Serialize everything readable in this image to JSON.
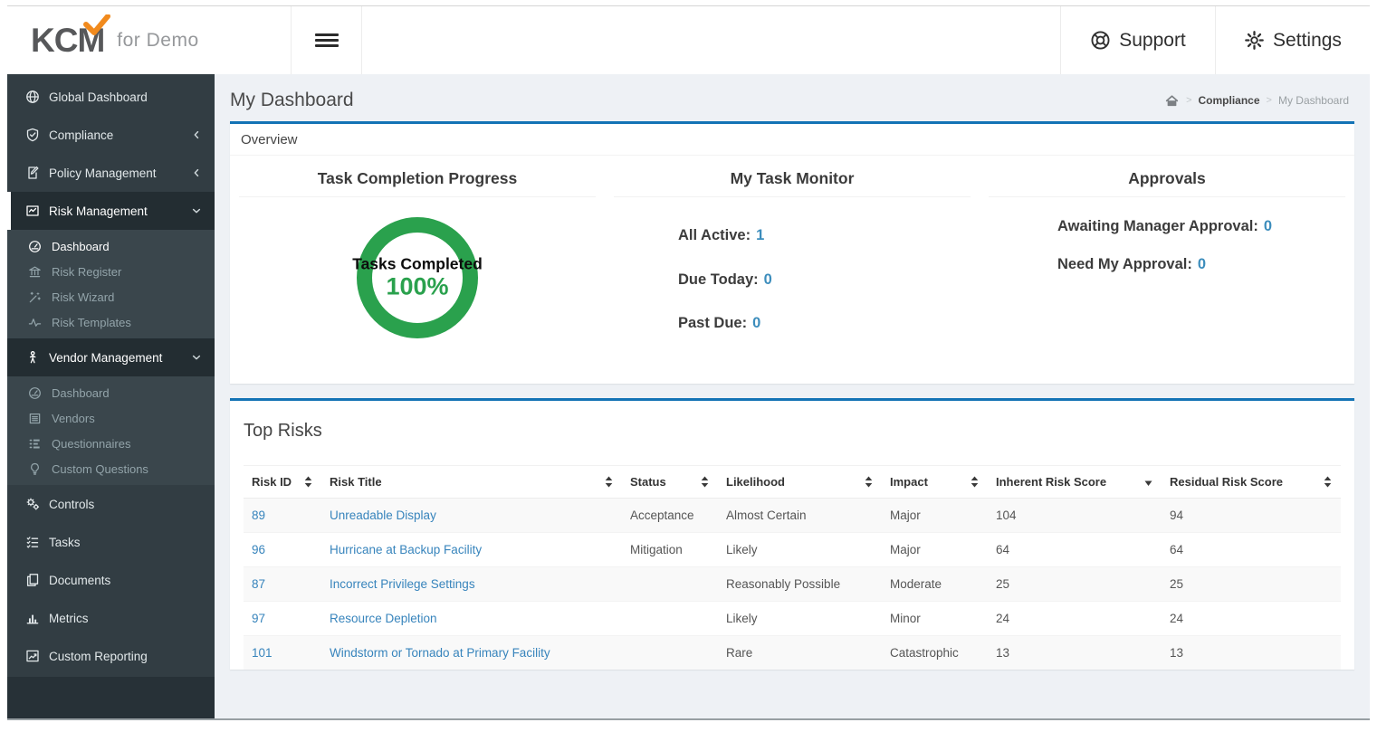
{
  "header": {
    "logo": {
      "brand": "KCM",
      "suffix": "for Demo"
    },
    "nav": [
      {
        "label": "Support",
        "icon": "life-ring"
      },
      {
        "label": "Settings",
        "icon": "gear"
      }
    ]
  },
  "page": {
    "title": "My Dashboard",
    "breadcrumb": {
      "parent": "Compliance",
      "current": "My Dashboard"
    }
  },
  "sidebar": {
    "items": [
      {
        "label": "Global Dashboard",
        "icon": "globe",
        "type": "top"
      },
      {
        "label": "Compliance",
        "icon": "shield-check",
        "type": "top",
        "chevron": "left"
      },
      {
        "label": "Policy Management",
        "icon": "policy-doc",
        "type": "top",
        "chevron": "left"
      },
      {
        "label": "Risk Management",
        "icon": "risk-chart",
        "type": "top",
        "chevron": "down",
        "expanded": true,
        "active": true
      },
      {
        "label": "Dashboard",
        "icon": "gauge",
        "type": "sub",
        "group": "risk",
        "active": true
      },
      {
        "label": "Risk Register",
        "icon": "bank",
        "type": "sub",
        "group": "risk"
      },
      {
        "label": "Risk Wizard",
        "icon": "wand",
        "type": "sub",
        "group": "risk"
      },
      {
        "label": "Risk Templates",
        "icon": "pulse",
        "type": "sub",
        "group": "risk"
      },
      {
        "label": "Vendor Management",
        "icon": "person",
        "type": "top",
        "chevron": "down",
        "expanded": true
      },
      {
        "label": "Dashboard",
        "icon": "gauge",
        "type": "sub",
        "group": "vendor"
      },
      {
        "label": "Vendors",
        "icon": "list-box",
        "type": "sub",
        "group": "vendor"
      },
      {
        "label": "Questionnaires",
        "icon": "list-items",
        "type": "sub",
        "group": "vendor"
      },
      {
        "label": "Custom Questions",
        "icon": "lightbulb",
        "type": "sub",
        "group": "vendor"
      },
      {
        "label": "Controls",
        "icon": "gears",
        "type": "top"
      },
      {
        "label": "Tasks",
        "icon": "task-list",
        "type": "top"
      },
      {
        "label": "Documents",
        "icon": "documents",
        "type": "top"
      },
      {
        "label": "Metrics",
        "icon": "bar-chart",
        "type": "top"
      },
      {
        "label": "Custom Reporting",
        "icon": "line-chart",
        "type": "top"
      }
    ]
  },
  "overview": {
    "panel_title": "Overview",
    "task_progress": {
      "title": "Task Completion Progress",
      "donut_label": "Tasks Completed",
      "donut_value": "100%",
      "percent": 100,
      "color": "#2aa14d"
    },
    "task_monitor": {
      "title": "My Task Monitor",
      "stats": [
        {
          "label": "All Active:",
          "value": "1"
        },
        {
          "label": "Due Today:",
          "value": "0"
        },
        {
          "label": "Past Due:",
          "value": "0"
        }
      ]
    },
    "approvals": {
      "title": "Approvals",
      "stats": [
        {
          "label": "Awaiting Manager Approval:",
          "value": "0"
        },
        {
          "label": "Need My Approval:",
          "value": "0"
        }
      ]
    }
  },
  "top_risks": {
    "title": "Top Risks",
    "columns": [
      {
        "key": "risk_id",
        "label": "Risk ID",
        "sort": "both"
      },
      {
        "key": "risk_title",
        "label": "Risk Title",
        "sort": "both"
      },
      {
        "key": "status",
        "label": "Status",
        "sort": "both"
      },
      {
        "key": "likelihood",
        "label": "Likelihood",
        "sort": "both"
      },
      {
        "key": "impact",
        "label": "Impact",
        "sort": "both"
      },
      {
        "key": "inherent_score",
        "label": "Inherent Risk Score",
        "sort": "desc"
      },
      {
        "key": "residual_score",
        "label": "Residual Risk Score",
        "sort": "both"
      }
    ],
    "rows": [
      {
        "risk_id": "89",
        "risk_title": "Unreadable Display",
        "status": "Acceptance",
        "likelihood": "Almost Certain",
        "impact": "Major",
        "inherent_score": "104",
        "residual_score": "94"
      },
      {
        "risk_id": "96",
        "risk_title": "Hurricane at Backup Facility",
        "status": "Mitigation",
        "likelihood": "Likely",
        "impact": "Major",
        "inherent_score": "64",
        "residual_score": "64"
      },
      {
        "risk_id": "87",
        "risk_title": "Incorrect Privilege Settings",
        "status": "",
        "likelihood": "Reasonably Possible",
        "impact": "Moderate",
        "inherent_score": "25",
        "residual_score": "25"
      },
      {
        "risk_id": "97",
        "risk_title": "Resource Depletion",
        "status": "",
        "likelihood": "Likely",
        "impact": "Minor",
        "inherent_score": "24",
        "residual_score": "24"
      },
      {
        "risk_id": "101",
        "risk_title": "Windstorm or Tornado at Primary Facility",
        "status": "",
        "likelihood": "Rare",
        "impact": "Catastrophic",
        "inherent_score": "13",
        "residual_score": "13"
      }
    ]
  },
  "colors": {
    "accent_blue": "#1373b5",
    "link_blue": "#3c8dbc",
    "progress_green": "#2aa14d",
    "sidebar_dark": "#323d43",
    "brand_orange": "#f18a1d"
  }
}
